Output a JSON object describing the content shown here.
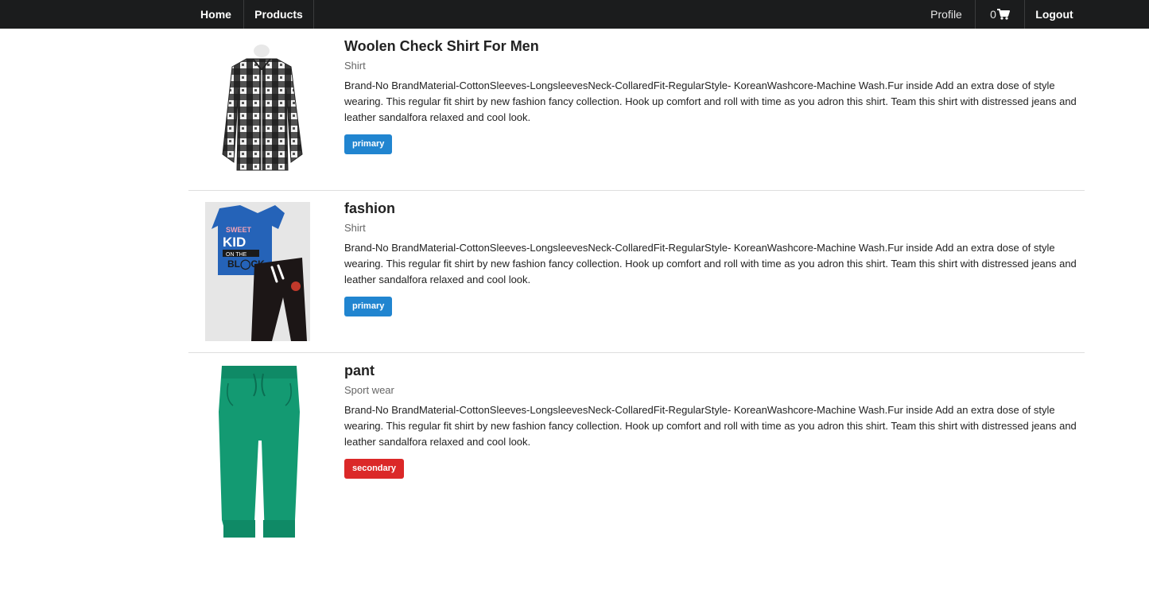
{
  "nav": {
    "home": "Home",
    "products": "Products",
    "profile": "Profile",
    "cart_count": "0",
    "cart_icon": "shopping-cart-icon",
    "logout": "Logout"
  },
  "colors": {
    "navbar_bg": "#1b1c1d",
    "label_primary": "#2185d0",
    "label_secondary": "#db2828"
  },
  "products": [
    {
      "title": "Woolen Check Shirt For Men",
      "category": "Shirt",
      "description": "Brand-No BrandMaterial-CottonSleeves-LongsleevesNeck-CollaredFit-RegularStyle- KoreanWashcore-Machine Wash.Fur inside  Add an extra dose of style wearing. This regular fit shirt by new fashion fancy collection. Hook up comfort and roll with time as you adron this shirt. Team this shirt with distressed jeans and leather sandalfora relaxed and cool look.",
      "label": "primary"
    },
    {
      "title": "fashion",
      "category": "Shirt",
      "description": "Brand-No BrandMaterial-CottonSleeves-LongsleevesNeck-CollaredFit-RegularStyle- KoreanWashcore-Machine Wash.Fur inside  Add an extra dose of style wearing. This regular fit shirt by new fashion fancy collection. Hook up comfort and roll with time as you adron this shirt. Team this shirt with distressed jeans and leather sandalfora relaxed and cool look.",
      "label": "primary"
    },
    {
      "title": "pant",
      "category": "Sport wear",
      "description": "Brand-No BrandMaterial-CottonSleeves-LongsleevesNeck-CollaredFit-RegularStyle- KoreanWashcore-Machine Wash.Fur inside  Add an extra dose of style wearing. This regular fit shirt by new fashion fancy collection. Hook up comfort and roll with time as you adron this shirt. Team this shirt with distressed jeans and leather sandalfora relaxed and cool look.",
      "label": "secondary"
    }
  ]
}
